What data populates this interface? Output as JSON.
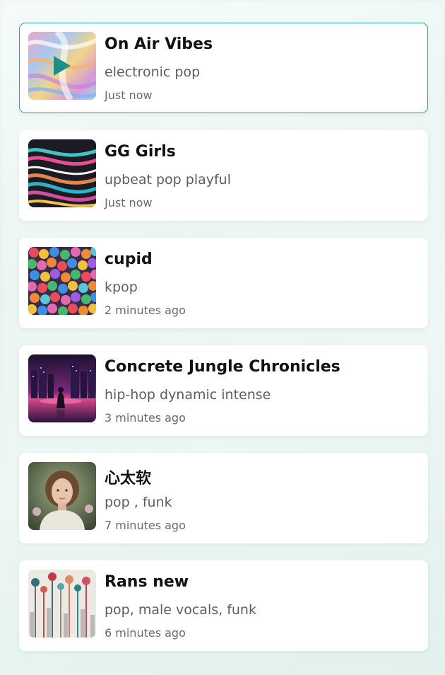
{
  "songs": [
    {
      "title": "On Air Vibes",
      "tags": "electronic pop",
      "time": "Just now",
      "selected": true,
      "cover_icon": "play-icon"
    },
    {
      "title": "GG Girls",
      "tags": "upbeat pop playful",
      "time": "Just now",
      "selected": false
    },
    {
      "title": "cupid",
      "tags": "kpop",
      "time": "2 minutes ago",
      "selected": false
    },
    {
      "title": "Concrete Jungle Chronicles",
      "tags": "hip-hop dynamic intense",
      "time": "3 minutes ago",
      "selected": false
    },
    {
      "title": "心太软",
      "tags": "pop , funk",
      "time": "7 minutes ago",
      "selected": false
    },
    {
      "title": "Rans new",
      "tags": "pop, male vocals, funk",
      "time": "6 minutes ago",
      "selected": false
    }
  ],
  "colors": {
    "selected_border": "#2aa5a9",
    "play_icon": "#1e8f86",
    "title": "#121212",
    "secondary": "#5e5e5e"
  }
}
